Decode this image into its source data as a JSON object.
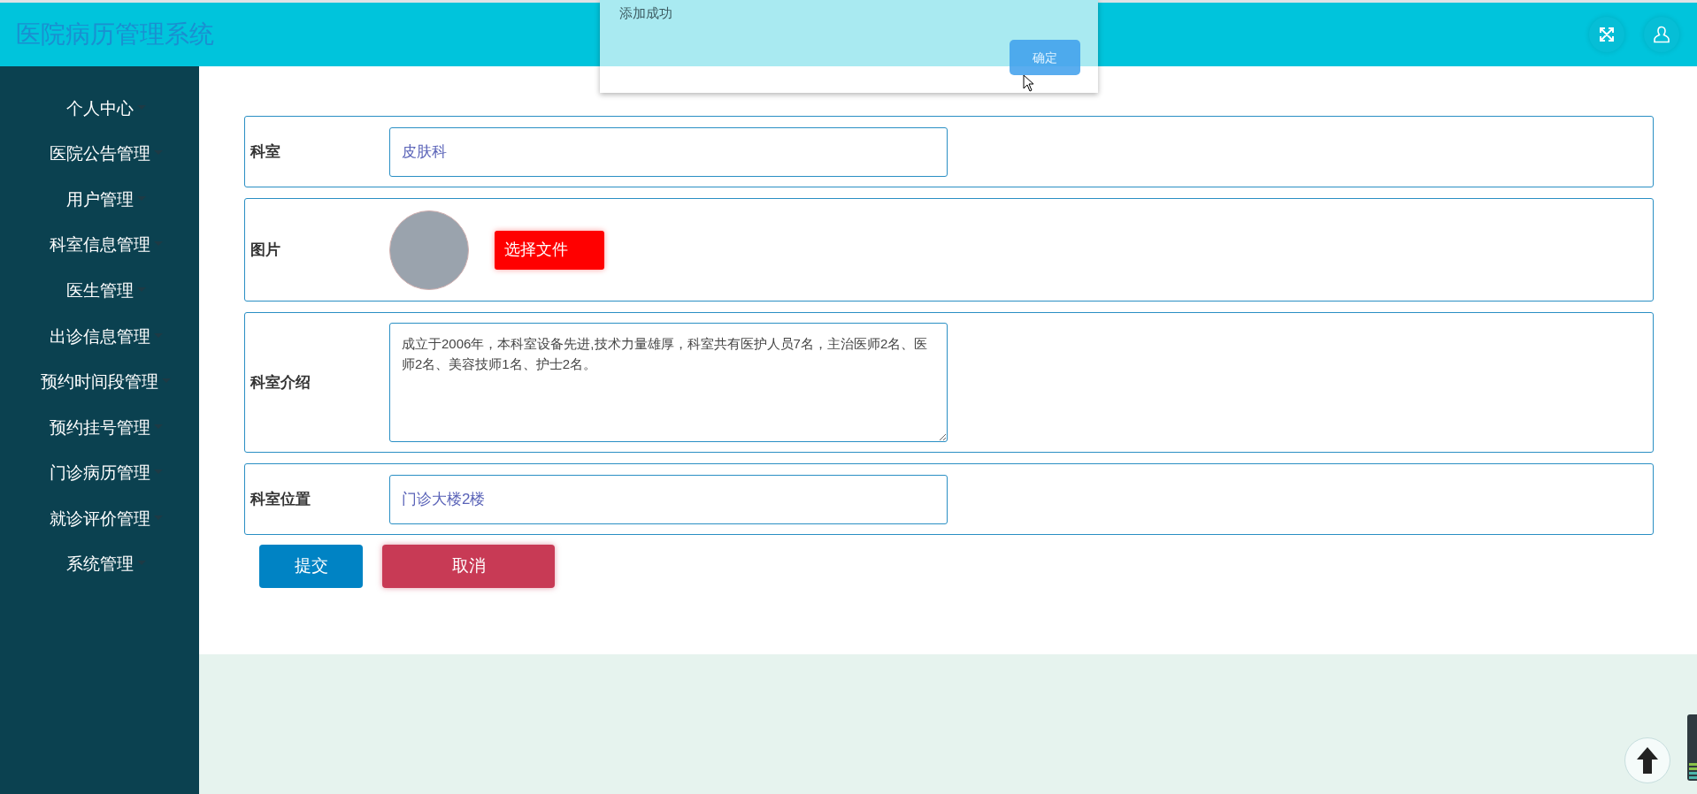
{
  "header": {
    "title": "医院病历管理系统"
  },
  "dialog": {
    "message": "添加成功",
    "button": "确定"
  },
  "sidebar": {
    "items": [
      {
        "label": "个人中心"
      },
      {
        "label": "医院公告管理"
      },
      {
        "label": "用户管理"
      },
      {
        "label": "科室信息管理"
      },
      {
        "label": "医生管理"
      },
      {
        "label": "出诊信息管理"
      },
      {
        "label": "预约时间段管理"
      },
      {
        "label": "预约挂号管理"
      },
      {
        "label": "门诊病历管理"
      },
      {
        "label": "就诊评价管理"
      },
      {
        "label": "系统管理"
      }
    ]
  },
  "form": {
    "fields": [
      {
        "kind": "text",
        "label": "科室",
        "value": "皮肤科"
      },
      {
        "kind": "image",
        "label": "图片",
        "button": "选择文件"
      },
      {
        "kind": "textarea",
        "label": "科室介绍",
        "value": "成立于2006年，本科室设备先进,技术力量雄厚，科室共有医护人员7名，主治医师2名、医师2名、美容技师1名、护士2名。"
      },
      {
        "kind": "text",
        "label": "科室位置",
        "value": "门诊大楼2楼"
      }
    ],
    "buttons": [
      {
        "kind": "submit",
        "label": "提交"
      },
      {
        "kind": "cancel",
        "label": "取消"
      }
    ]
  }
}
